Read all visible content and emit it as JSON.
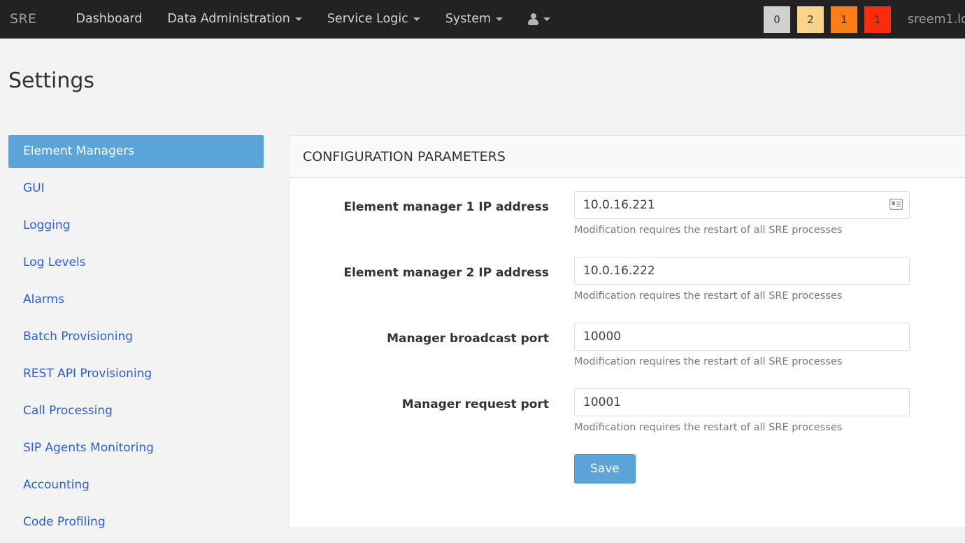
{
  "navbar": {
    "brand": "SRE",
    "links": [
      {
        "label": "Dashboard",
        "caret": false,
        "name": "nav-dashboard"
      },
      {
        "label": "Data Administration",
        "caret": true,
        "name": "nav-data-administration"
      },
      {
        "label": "Service Logic",
        "caret": true,
        "name": "nav-service-logic"
      },
      {
        "label": "System",
        "caret": true,
        "name": "nav-system"
      }
    ],
    "user_menu_icon": "user-icon",
    "badges": [
      {
        "value": "0",
        "color": "#d0d0d0",
        "text_color": "#333333"
      },
      {
        "value": "2",
        "color": "#fcd38a",
        "text_color": "#333333"
      },
      {
        "value": "1",
        "color": "#fd7e14",
        "text_color": "#333333"
      },
      {
        "value": "1",
        "color": "#f92d0c",
        "text_color": "#333333"
      }
    ],
    "username": "sreem1.lo"
  },
  "page": {
    "title": "Settings"
  },
  "sidebar": {
    "items": [
      {
        "label": "Element Managers",
        "active": true
      },
      {
        "label": "GUI",
        "active": false
      },
      {
        "label": "Logging",
        "active": false
      },
      {
        "label": "Log Levels",
        "active": false
      },
      {
        "label": "Alarms",
        "active": false
      },
      {
        "label": "Batch Provisioning",
        "active": false
      },
      {
        "label": "REST API Provisioning",
        "active": false
      },
      {
        "label": "Call Processing",
        "active": false
      },
      {
        "label": "SIP Agents Monitoring",
        "active": false
      },
      {
        "label": "Accounting",
        "active": false
      },
      {
        "label": "Code Profiling",
        "active": false
      }
    ]
  },
  "panel": {
    "title": "CONFIGURATION PARAMETERS",
    "fields": [
      {
        "label": "Element manager 1 IP address",
        "value": "10.0.16.221",
        "placeholder": "",
        "help": "Modification requires the restart of all SRE processes",
        "icon": "address-card-icon",
        "has_icon": true,
        "name": "element-manager-1-ip-input"
      },
      {
        "label": "Element manager 2 IP address",
        "value": "10.0.16.222",
        "placeholder": "",
        "help": "Modification requires the restart of all SRE processes",
        "icon": "",
        "has_icon": false,
        "name": "element-manager-2-ip-input"
      },
      {
        "label": "Manager broadcast port",
        "value": "10000",
        "placeholder": "",
        "help": "Modification requires the restart of all SRE processes",
        "icon": "",
        "has_icon": false,
        "name": "manager-broadcast-port-input"
      },
      {
        "label": "Manager request port",
        "value": "10001",
        "placeholder": "",
        "help": "Modification requires the restart of all SRE processes",
        "icon": "",
        "has_icon": false,
        "name": "manager-request-port-input"
      }
    ],
    "save_label": "Save"
  },
  "colors": {
    "navbar_bg": "#222222",
    "accent_blue": "#5ba4d9",
    "link_blue": "#2b5fd9",
    "page_bg": "#f3f3f3"
  }
}
